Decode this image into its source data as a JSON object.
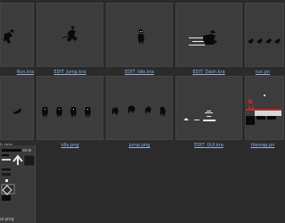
{
  "browser": {
    "files": [
      {
        "name": "Run.kra",
        "display": "Run.kra",
        "kind": "kra"
      },
      {
        "name": "EDIT_Jump.kra",
        "display": "EDIT_Jump.kra",
        "kind": "kra"
      },
      {
        "name": "EDIT_Idle.kra",
        "display": "EDIT_Idle.kra",
        "kind": "kra"
      },
      {
        "name": "EDIT_Dash.kra",
        "display": "EDIT_Dash.kra",
        "kind": "kra"
      },
      {
        "name": "run.png",
        "display": "run.pn",
        "kind": "png"
      },
      {
        "name": "dash.png",
        "display": "h.png",
        "kind": "png"
      },
      {
        "name": "idle.png",
        "display": "idle.png",
        "kind": "png"
      },
      {
        "name": "jump.png",
        "display": "jump.png",
        "kind": "png"
      },
      {
        "name": "EDIT_GUI.kra",
        "display": "EDIT_GUI.kra",
        "kind": "kra"
      },
      {
        "name": "tilemap.png",
        "display": "tilemap.pn",
        "kind": "png"
      }
    ],
    "selected_panel_label": "ui.png"
  },
  "colors": {
    "background": "#2b2b2b",
    "thumb": "#3c3c3c",
    "sprite": "#0a0a0a",
    "accent_red": "#c0262b"
  }
}
